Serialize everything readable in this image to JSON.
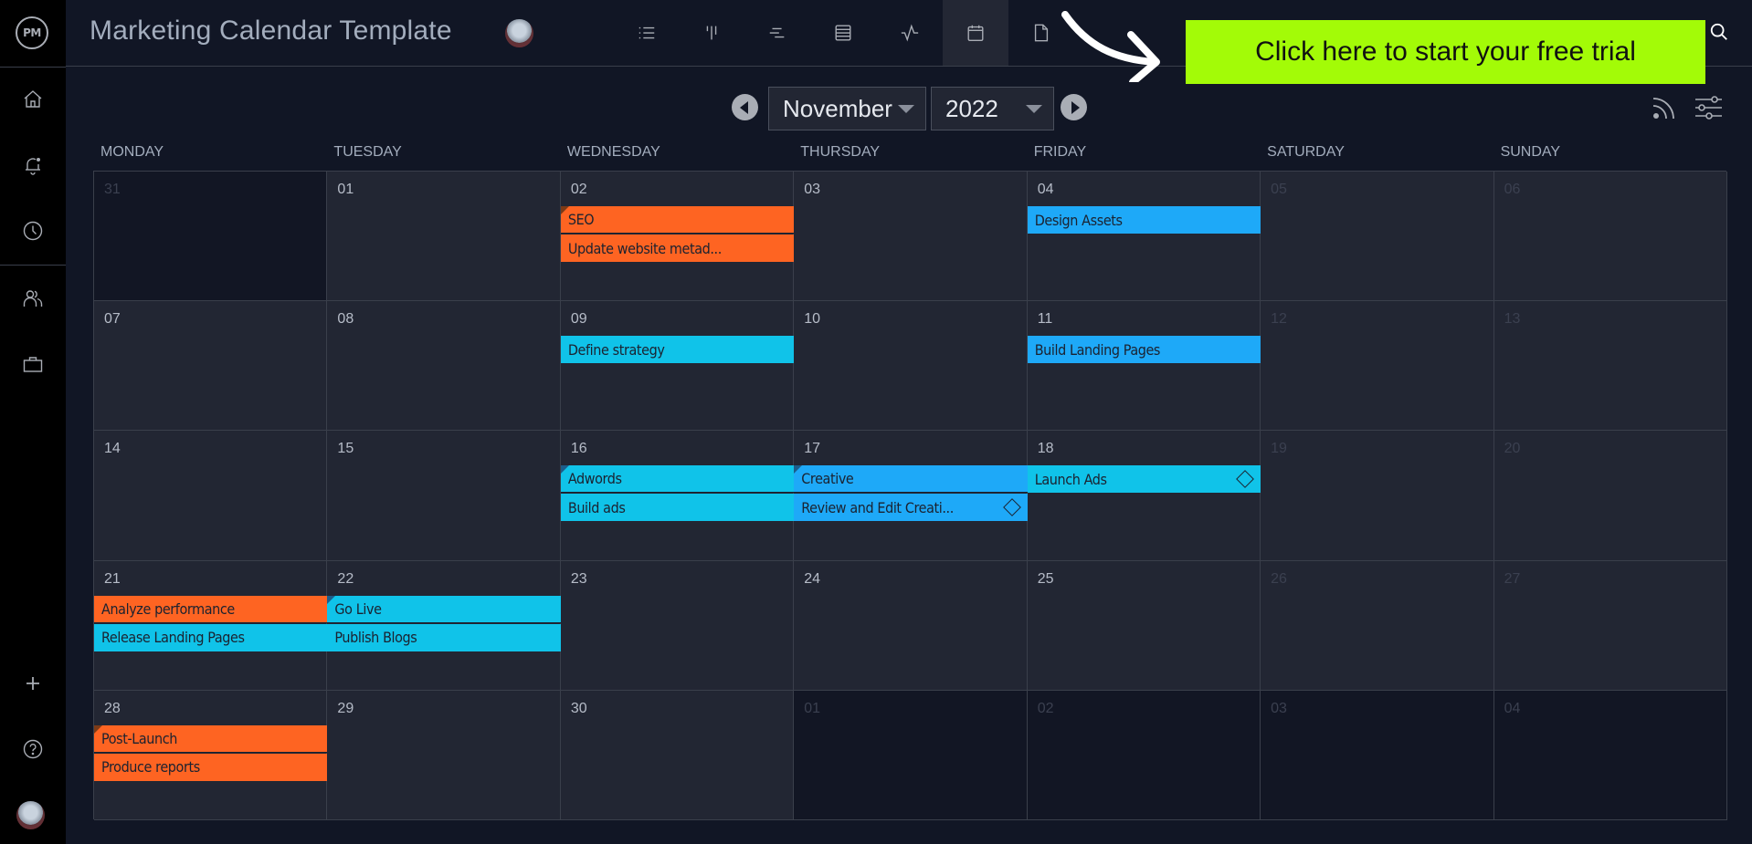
{
  "app": {
    "logo_text": "PM",
    "title": "Marketing Calendar Template"
  },
  "sidebar": {
    "items": [
      {
        "name": "home",
        "icon": "home-icon"
      },
      {
        "name": "notifications",
        "icon": "bell-icon"
      },
      {
        "name": "timesheets",
        "icon": "clock-icon"
      },
      {
        "name": "team",
        "icon": "people-icon"
      },
      {
        "name": "portfolio",
        "icon": "briefcase-icon"
      }
    ],
    "bottom": [
      {
        "name": "add",
        "icon": "plus-icon"
      },
      {
        "name": "help",
        "icon": "help-icon"
      },
      {
        "name": "profile",
        "icon": "avatar"
      }
    ]
  },
  "views": [
    {
      "name": "list",
      "icon": "list-icon",
      "active": false
    },
    {
      "name": "board",
      "icon": "board-icon",
      "active": false
    },
    {
      "name": "gantt",
      "icon": "gantt-icon",
      "active": false
    },
    {
      "name": "sheet",
      "icon": "sheet-icon",
      "active": false
    },
    {
      "name": "dashboard",
      "icon": "pulse-icon",
      "active": false
    },
    {
      "name": "calendar",
      "icon": "calendar-icon",
      "active": true
    },
    {
      "name": "files",
      "icon": "file-icon",
      "active": false
    }
  ],
  "cta": {
    "label": "Click here to start your free trial",
    "color": "#a3fb07"
  },
  "calendar": {
    "month": "November",
    "year": "2022",
    "weekdays": [
      "MONDAY",
      "TUESDAY",
      "WEDNESDAY",
      "THURSDAY",
      "FRIDAY",
      "SATURDAY",
      "SUNDAY"
    ],
    "weeks": [
      [
        {
          "day": "31",
          "out": true,
          "dim": true
        },
        {
          "day": "01"
        },
        {
          "day": "02",
          "events": [
            {
              "label": "SEO",
              "color": "orange",
              "corner": true
            },
            {
              "label": "Update website metad...",
              "color": "orange"
            }
          ]
        },
        {
          "day": "03"
        },
        {
          "day": "04",
          "events": [
            {
              "label": "Design Assets",
              "color": "blue"
            }
          ]
        },
        {
          "day": "05",
          "dim": true
        },
        {
          "day": "06",
          "dim": true
        }
      ],
      [
        {
          "day": "07"
        },
        {
          "day": "08"
        },
        {
          "day": "09",
          "events": [
            {
              "label": "Define strategy",
              "color": "cyan"
            }
          ]
        },
        {
          "day": "10"
        },
        {
          "day": "11",
          "events": [
            {
              "label": "Build Landing Pages",
              "color": "blue"
            }
          ]
        },
        {
          "day": "12",
          "dim": true
        },
        {
          "day": "13",
          "dim": true
        }
      ],
      [
        {
          "day": "14"
        },
        {
          "day": "15"
        },
        {
          "day": "16",
          "events": [
            {
              "label": "Adwords",
              "color": "cyan",
              "corner": true
            },
            {
              "label": "Build ads",
              "color": "cyan"
            }
          ]
        },
        {
          "day": "17",
          "events": [
            {
              "label": "Creative",
              "color": "blue",
              "corner": true
            },
            {
              "label": "Review and Edit Creati...",
              "color": "blue",
              "milestone": true
            }
          ]
        },
        {
          "day": "18",
          "events": [
            {
              "label": "Launch Ads",
              "color": "cyan",
              "milestone": true
            }
          ]
        },
        {
          "day": "19",
          "dim": true
        },
        {
          "day": "20",
          "dim": true
        }
      ],
      [
        {
          "day": "21",
          "events": [
            {
              "label": "Analyze performance",
              "color": "orange"
            },
            {
              "label": "Release Landing Pages",
              "color": "cyan"
            }
          ]
        },
        {
          "day": "22",
          "events": [
            {
              "label": "Go Live",
              "color": "cyan",
              "corner": true
            },
            {
              "label": "Publish Blogs",
              "color": "cyan"
            }
          ]
        },
        {
          "day": "23"
        },
        {
          "day": "24"
        },
        {
          "day": "25"
        },
        {
          "day": "26",
          "dim": true
        },
        {
          "day": "27",
          "dim": true
        }
      ],
      [
        {
          "day": "28",
          "events": [
            {
              "label": "Post-Launch",
              "color": "orange",
              "corner": true
            },
            {
              "label": "Produce reports",
              "color": "orange"
            }
          ]
        },
        {
          "day": "29"
        },
        {
          "day": "30"
        },
        {
          "day": "01",
          "out": true,
          "dim": true
        },
        {
          "day": "02",
          "out": true,
          "dim": true
        },
        {
          "day": "03",
          "out": true,
          "dim": true
        },
        {
          "day": "04",
          "out": true,
          "dim": true
        }
      ]
    ]
  },
  "colors": {
    "orange": "#fe6422",
    "cyan": "#10c3e9",
    "blue": "#1ea9f8",
    "background": "#111625",
    "cell": "#222633",
    "sidebar": "#000000"
  }
}
